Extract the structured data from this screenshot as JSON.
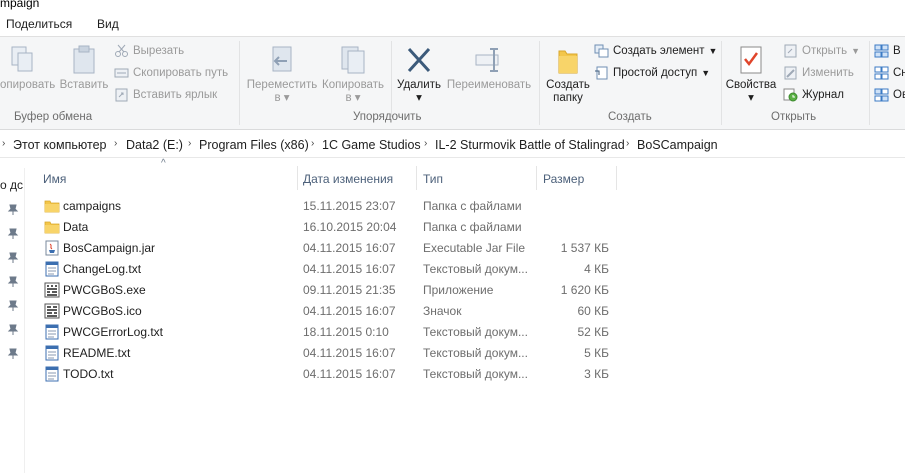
{
  "window": {
    "title_fragment": "mpaign"
  },
  "tabs": [
    {
      "label": "Поделиться"
    },
    {
      "label": "Вид"
    }
  ],
  "ribbon": {
    "clipboard": {
      "label": "Буфер обмена",
      "copy_label": "опировать",
      "paste_label": "Вставить",
      "cut_label": "Вырезать",
      "copy_path_label": "Скопировать путь",
      "paste_shortcut_label": "Вставить ярлык"
    },
    "organize": {
      "label": "Упорядочить",
      "move_label": "Переместить",
      "move_sub": "в",
      "copyto_label": "Копировать",
      "copyto_sub": "в",
      "delete_label": "Удалить",
      "rename_label": "Переименовать"
    },
    "create": {
      "label": "Создать",
      "new_folder_line1": "Создать",
      "new_folder_line2": "папку",
      "new_item_label": "Создать элемент",
      "easy_access_label": "Простой доступ"
    },
    "open": {
      "label": "Открыть",
      "properties_label": "Свойства",
      "open_label": "Открыть",
      "edit_label": "Изменить",
      "history_label": "Журнал"
    },
    "select": {
      "item1": "В",
      "item2": "Сн",
      "item3": "Ов"
    }
  },
  "breadcrumb": [
    "Этот компьютер",
    "Data2 (E:)",
    "Program Files (x86)",
    "1C Game Studios",
    "IL-2 Sturmovik Battle of Stalingrad",
    "BoSCampaign"
  ],
  "nav": {
    "partial_label": "о дс"
  },
  "columns": {
    "name": "Имя",
    "date": "Дата изменения",
    "type": "Тип",
    "size": "Размер"
  },
  "files": [
    {
      "name": "campaigns",
      "date": "15.11.2015 23:07",
      "type": "Папка с файлами",
      "size": "",
      "icon": "folder-icon"
    },
    {
      "name": "Data",
      "date": "16.10.2015 20:04",
      "type": "Папка с файлами",
      "size": "",
      "icon": "folder-icon"
    },
    {
      "name": "BosCampaign.jar",
      "date": "04.11.2015 16:07",
      "type": "Executable Jar File",
      "size": "1 537 КБ",
      "icon": "jar-file-icon"
    },
    {
      "name": "ChangeLog.txt",
      "date": "04.11.2015 16:07",
      "type": "Текстовый докум...",
      "size": "4 КБ",
      "icon": "text-file-icon"
    },
    {
      "name": "PWCGBoS.exe",
      "date": "09.11.2015 21:35",
      "type": "Приложение",
      "size": "1 620 КБ",
      "icon": "exe-file-icon"
    },
    {
      "name": "PWCGBoS.ico",
      "date": "04.11.2015 16:07",
      "type": "Значок",
      "size": "60 КБ",
      "icon": "ico-file-icon"
    },
    {
      "name": "PWCGErrorLog.txt",
      "date": "18.11.2015 0:10",
      "type": "Текстовый докум...",
      "size": "52 КБ",
      "icon": "text-file-icon"
    },
    {
      "name": "README.txt",
      "date": "04.11.2015 16:07",
      "type": "Текстовый докум...",
      "size": "5 КБ",
      "icon": "text-file-icon"
    },
    {
      "name": "TODO.txt",
      "date": "04.11.2015 16:07",
      "type": "Текстовый докум...",
      "size": "3 КБ",
      "icon": "text-file-icon"
    }
  ]
}
